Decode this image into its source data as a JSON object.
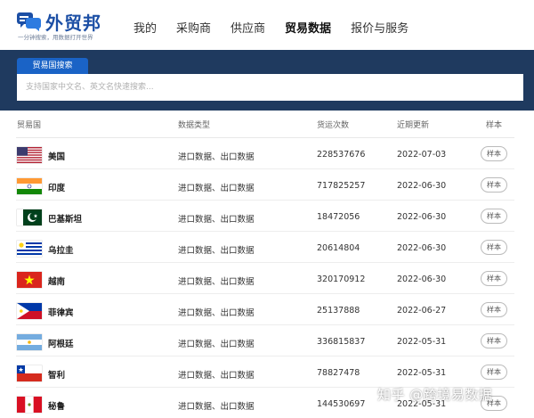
{
  "brand": {
    "name": "外贸邦",
    "slogan": "一分钟搜索，用数据打开世界"
  },
  "nav": {
    "items": [
      "我的",
      "采购商",
      "供应商",
      "贸易数据",
      "报价与服务"
    ],
    "active": "贸易数据"
  },
  "search": {
    "tab_label": "贸易国搜索",
    "placeholder": "支持国家中文名、英文名快速搜索..."
  },
  "table": {
    "headers": [
      "贸易国",
      "数据类型",
      "货运次数",
      "近期更新",
      "样本"
    ],
    "rows": [
      {
        "flag": "us-flag-icon",
        "country": "美国",
        "types": "进口数据、出口数据",
        "count": "228537676",
        "date": "2022-07-03",
        "sample": "样本"
      },
      {
        "flag": "india-flag-icon",
        "country": "印度",
        "types": "进口数据、出口数据",
        "count": "717825257",
        "date": "2022-06-30",
        "sample": "样本"
      },
      {
        "flag": "pakistan-flag-icon",
        "country": "巴基斯坦",
        "types": "进口数据、出口数据",
        "count": "18472056",
        "date": "2022-06-30",
        "sample": "样本"
      },
      {
        "flag": "uruguay-flag-icon",
        "country": "乌拉圭",
        "types": "进口数据、出口数据",
        "count": "20614804",
        "date": "2022-06-30",
        "sample": "样本"
      },
      {
        "flag": "vietnam-flag-icon",
        "country": "越南",
        "types": "进口数据、出口数据",
        "count": "320170912",
        "date": "2022-06-30",
        "sample": "样本"
      },
      {
        "flag": "philippines-flag-icon",
        "country": "菲律宾",
        "types": "进口数据、出口数据",
        "count": "25137888",
        "date": "2022-06-27",
        "sample": "样本"
      },
      {
        "flag": "argentina-flag-icon",
        "country": "阿根廷",
        "types": "进口数据、出口数据",
        "count": "336815837",
        "date": "2022-05-31",
        "sample": "样本"
      },
      {
        "flag": "chile-flag-icon",
        "country": "智利",
        "types": "进口数据、出口数据",
        "count": "78827478",
        "date": "2022-05-31",
        "sample": "样本"
      },
      {
        "flag": "peru-flag-icon",
        "country": "秘鲁",
        "types": "进口数据、出口数据",
        "count": "144530697",
        "date": "2022-05-31",
        "sample": "样本"
      }
    ]
  },
  "watermark": "知乎 @跨境易数据",
  "colors": {
    "brand_blue": "#1c4fa5",
    "search_panel": "#1f3a5f",
    "search_tab": "#1a63c6"
  }
}
